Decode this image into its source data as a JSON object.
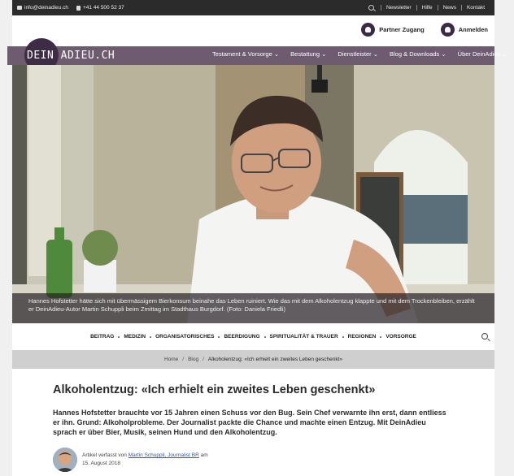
{
  "topbar": {
    "email": "info@deinadieu.ch",
    "phone": "+41 44 500 52 37",
    "links": [
      "Newsletter",
      "Hilfe",
      "News",
      "Kontakt"
    ]
  },
  "header": {
    "partner_label": "Partner Zugang",
    "login_label": "Anmelden"
  },
  "logo": {
    "text": "DEIN ADIEU.CH"
  },
  "nav": {
    "items": [
      "Testament & Vorsorge ⌄",
      "Bestattung ⌄",
      "Dienstleister ⌄",
      "Blog & Downloads ⌄",
      "Über DeinAdieu ⌄"
    ]
  },
  "hero": {
    "caption": "Hannes Hofstetter hätte sich mit übermässigem Bierkonsum beinahe das Leben ruiniert. Wie das mit dem Alkoholentzug klappte und mit dem Trockenbleiben, erzählt er DeinAdieu-Autor Martin Schuppli beim Zmittag im Stadthaus Burgdorf. (Foto: Daniela Friedli)"
  },
  "categories": [
    "BEITRAG",
    "MEDIZIN",
    "ORGANISATORISCHES",
    "BEERDIGUNG",
    "SPIRITUALITÄT & TRAUER",
    "REGIONEN",
    "VORSORGE"
  ],
  "breadcrumb": {
    "home": "Home",
    "blog": "Blog",
    "current": "Alkoholentzug: «Ich erhielt ein zweites Leben geschenkt»"
  },
  "article": {
    "title": "Alkoholentzug: «Ich erhielt ein zweites Leben geschenkt»",
    "lead": "Hannes Hofstetter brauchte vor 15 Jahren einen Schuss vor den Bug. Sein Chef verwarnte ihn erst, dann entliess er ihn. Grund: Alkoholprobleme. Der Journalist packte die Chance und machte einen Entzug. Mit DeinAdieu sprach er über Bier, Musik, seinen Hund und den Alkoholentzug.",
    "author_prefix": "Artikel verfasst von",
    "author_name": "Martin Schuppli, Journalist BR",
    "author_suffix": "am",
    "date": "15. August 2018"
  },
  "colors": {
    "nav_purple": "#6e5b70",
    "logo_dark": "#3e2c46",
    "topbar": "#2b2b2b"
  },
  "icons": [
    "mail-icon",
    "phone-icon",
    "search-icon",
    "partner-icon",
    "user-icon"
  ]
}
